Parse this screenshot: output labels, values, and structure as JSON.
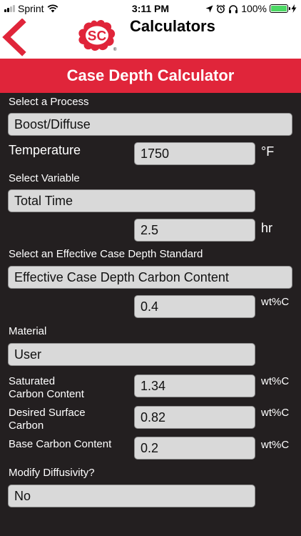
{
  "status": {
    "carrier": "Sprint",
    "time": "3:11 PM",
    "battery_percent": "100%",
    "battery_level": 1.0,
    "battery_color": "#4cd964"
  },
  "nav": {
    "back_icon": "chevron-left-icon",
    "logo_text": "SC",
    "logo_mark": "®",
    "title": "Calculators",
    "accent_color": "#e0253a"
  },
  "header": {
    "title": "Case Depth Calculator"
  },
  "form": {
    "process_label": "Select a Process",
    "process_value": "Boost/Diffuse",
    "temperature_label": "Temperature",
    "temperature_value": "1750",
    "temperature_unit": "°F",
    "variable_label": "Select Variable",
    "variable_value": "Total Time",
    "time_value": "2.5",
    "time_unit": "hr",
    "standard_label": "Select an Effective Case Depth Standard",
    "standard_value": "Effective Case Depth Carbon Content",
    "standard_carbon_value": "0.4",
    "standard_carbon_unit": "wt%C",
    "material_label": "Material",
    "material_value": "User",
    "saturated_label_1": "Saturated",
    "saturated_label_2": "Carbon Content",
    "saturated_value": "1.34",
    "saturated_unit": "wt%C",
    "desired_label_1": "Desired Surface",
    "desired_label_2": "Carbon",
    "desired_value": "0.82",
    "desired_unit": "wt%C",
    "base_label": "Base Carbon Content",
    "base_value": "0.2",
    "base_unit": "wt%C",
    "diffusivity_label": "Modify Diffusivity?",
    "diffusivity_value": "No"
  }
}
